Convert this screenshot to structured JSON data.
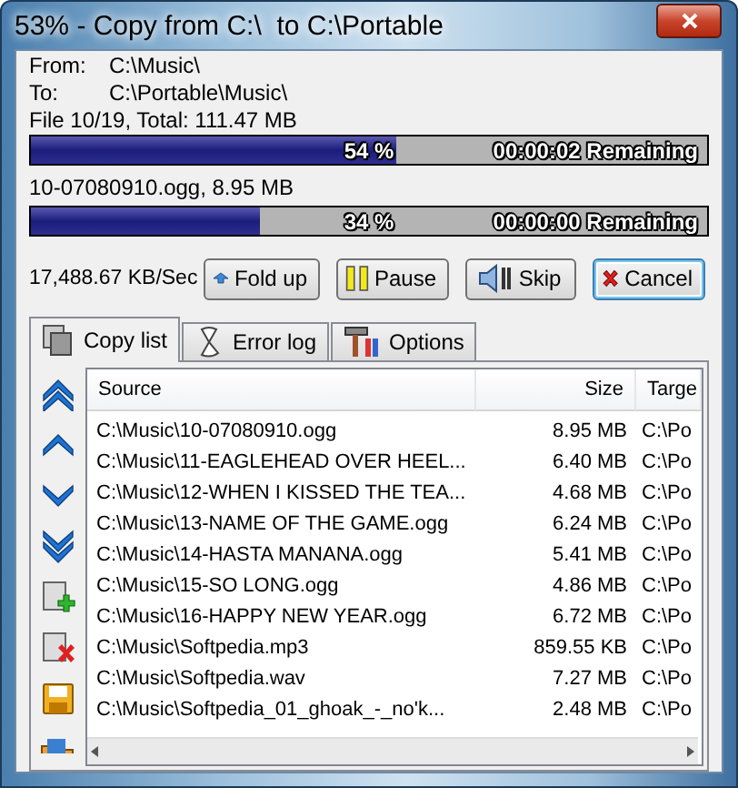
{
  "window": {
    "title": "53% - Copy from C:\\  to C:\\Portable"
  },
  "paths": [
    {
      "label": "From:",
      "value": "C:\\Music\\"
    },
    {
      "label": "To:",
      "value": "C:\\Portable\\Music\\"
    }
  ],
  "total": {
    "caption": "File 10/19, Total: 111.47 MB",
    "progress": {
      "level": 0.54,
      "percent": "54 %",
      "remaining": "00:00:02 Remaining"
    }
  },
  "current": {
    "caption": "10-07080910.ogg, 8.95 MB",
    "progress": {
      "level": 0.34,
      "percent": "34 %",
      "remaining": "00:00:00 Remaining"
    }
  },
  "speed": "17,488.67 KB/Sec",
  "buttons": [
    {
      "label": "Fold up",
      "kind": "fold",
      "focused": false
    },
    {
      "label": "Pause",
      "kind": "pause",
      "focused": false
    },
    {
      "label": "Skip",
      "kind": "skip",
      "focused": false
    },
    {
      "label": "Cancel",
      "kind": "cancel",
      "focused": true
    }
  ],
  "tabs": [
    {
      "label": "Copy list",
      "kind": "copy",
      "selected": true
    },
    {
      "label": "Error log",
      "kind": "log",
      "selected": false
    },
    {
      "label": "Options",
      "kind": "options",
      "selected": false
    }
  ],
  "table": {
    "columns": [
      "Source",
      "Size",
      "Targe"
    ],
    "rows": [
      {
        "source": "C:\\Music\\10-07080910.ogg",
        "size": "8.95 MB",
        "target": "C:\\Po"
      },
      {
        "source": "C:\\Music\\11-EAGLEHEAD OVER HEEL...",
        "size": "6.40 MB",
        "target": "C:\\Po"
      },
      {
        "source": "C:\\Music\\12-WHEN I KISSED THE TEA...",
        "size": "4.68 MB",
        "target": "C:\\Po"
      },
      {
        "source": "C:\\Music\\13-NAME OF THE GAME.ogg",
        "size": "6.24 MB",
        "target": "C:\\Po"
      },
      {
        "source": "C:\\Music\\14-HASTA MANANA.ogg",
        "size": "5.41 MB",
        "target": "C:\\Po"
      },
      {
        "source": "C:\\Music\\15-SO LONG.ogg",
        "size": "4.86 MB",
        "target": "C:\\Po"
      },
      {
        "source": "C:\\Music\\16-HAPPY NEW YEAR.ogg",
        "size": "6.72 MB",
        "target": "C:\\Po"
      },
      {
        "source": "C:\\Music\\Softpedia.mp3",
        "size": "859.55 KB",
        "target": "C:\\Po"
      },
      {
        "source": "C:\\Music\\Softpedia.wav",
        "size": "7.27 MB",
        "target": "C:\\Po"
      },
      {
        "source": "C:\\Music\\Softpedia_01_ghoak_-_no'k...",
        "size": "2.48 MB",
        "target": "C:\\Po"
      }
    ]
  }
}
